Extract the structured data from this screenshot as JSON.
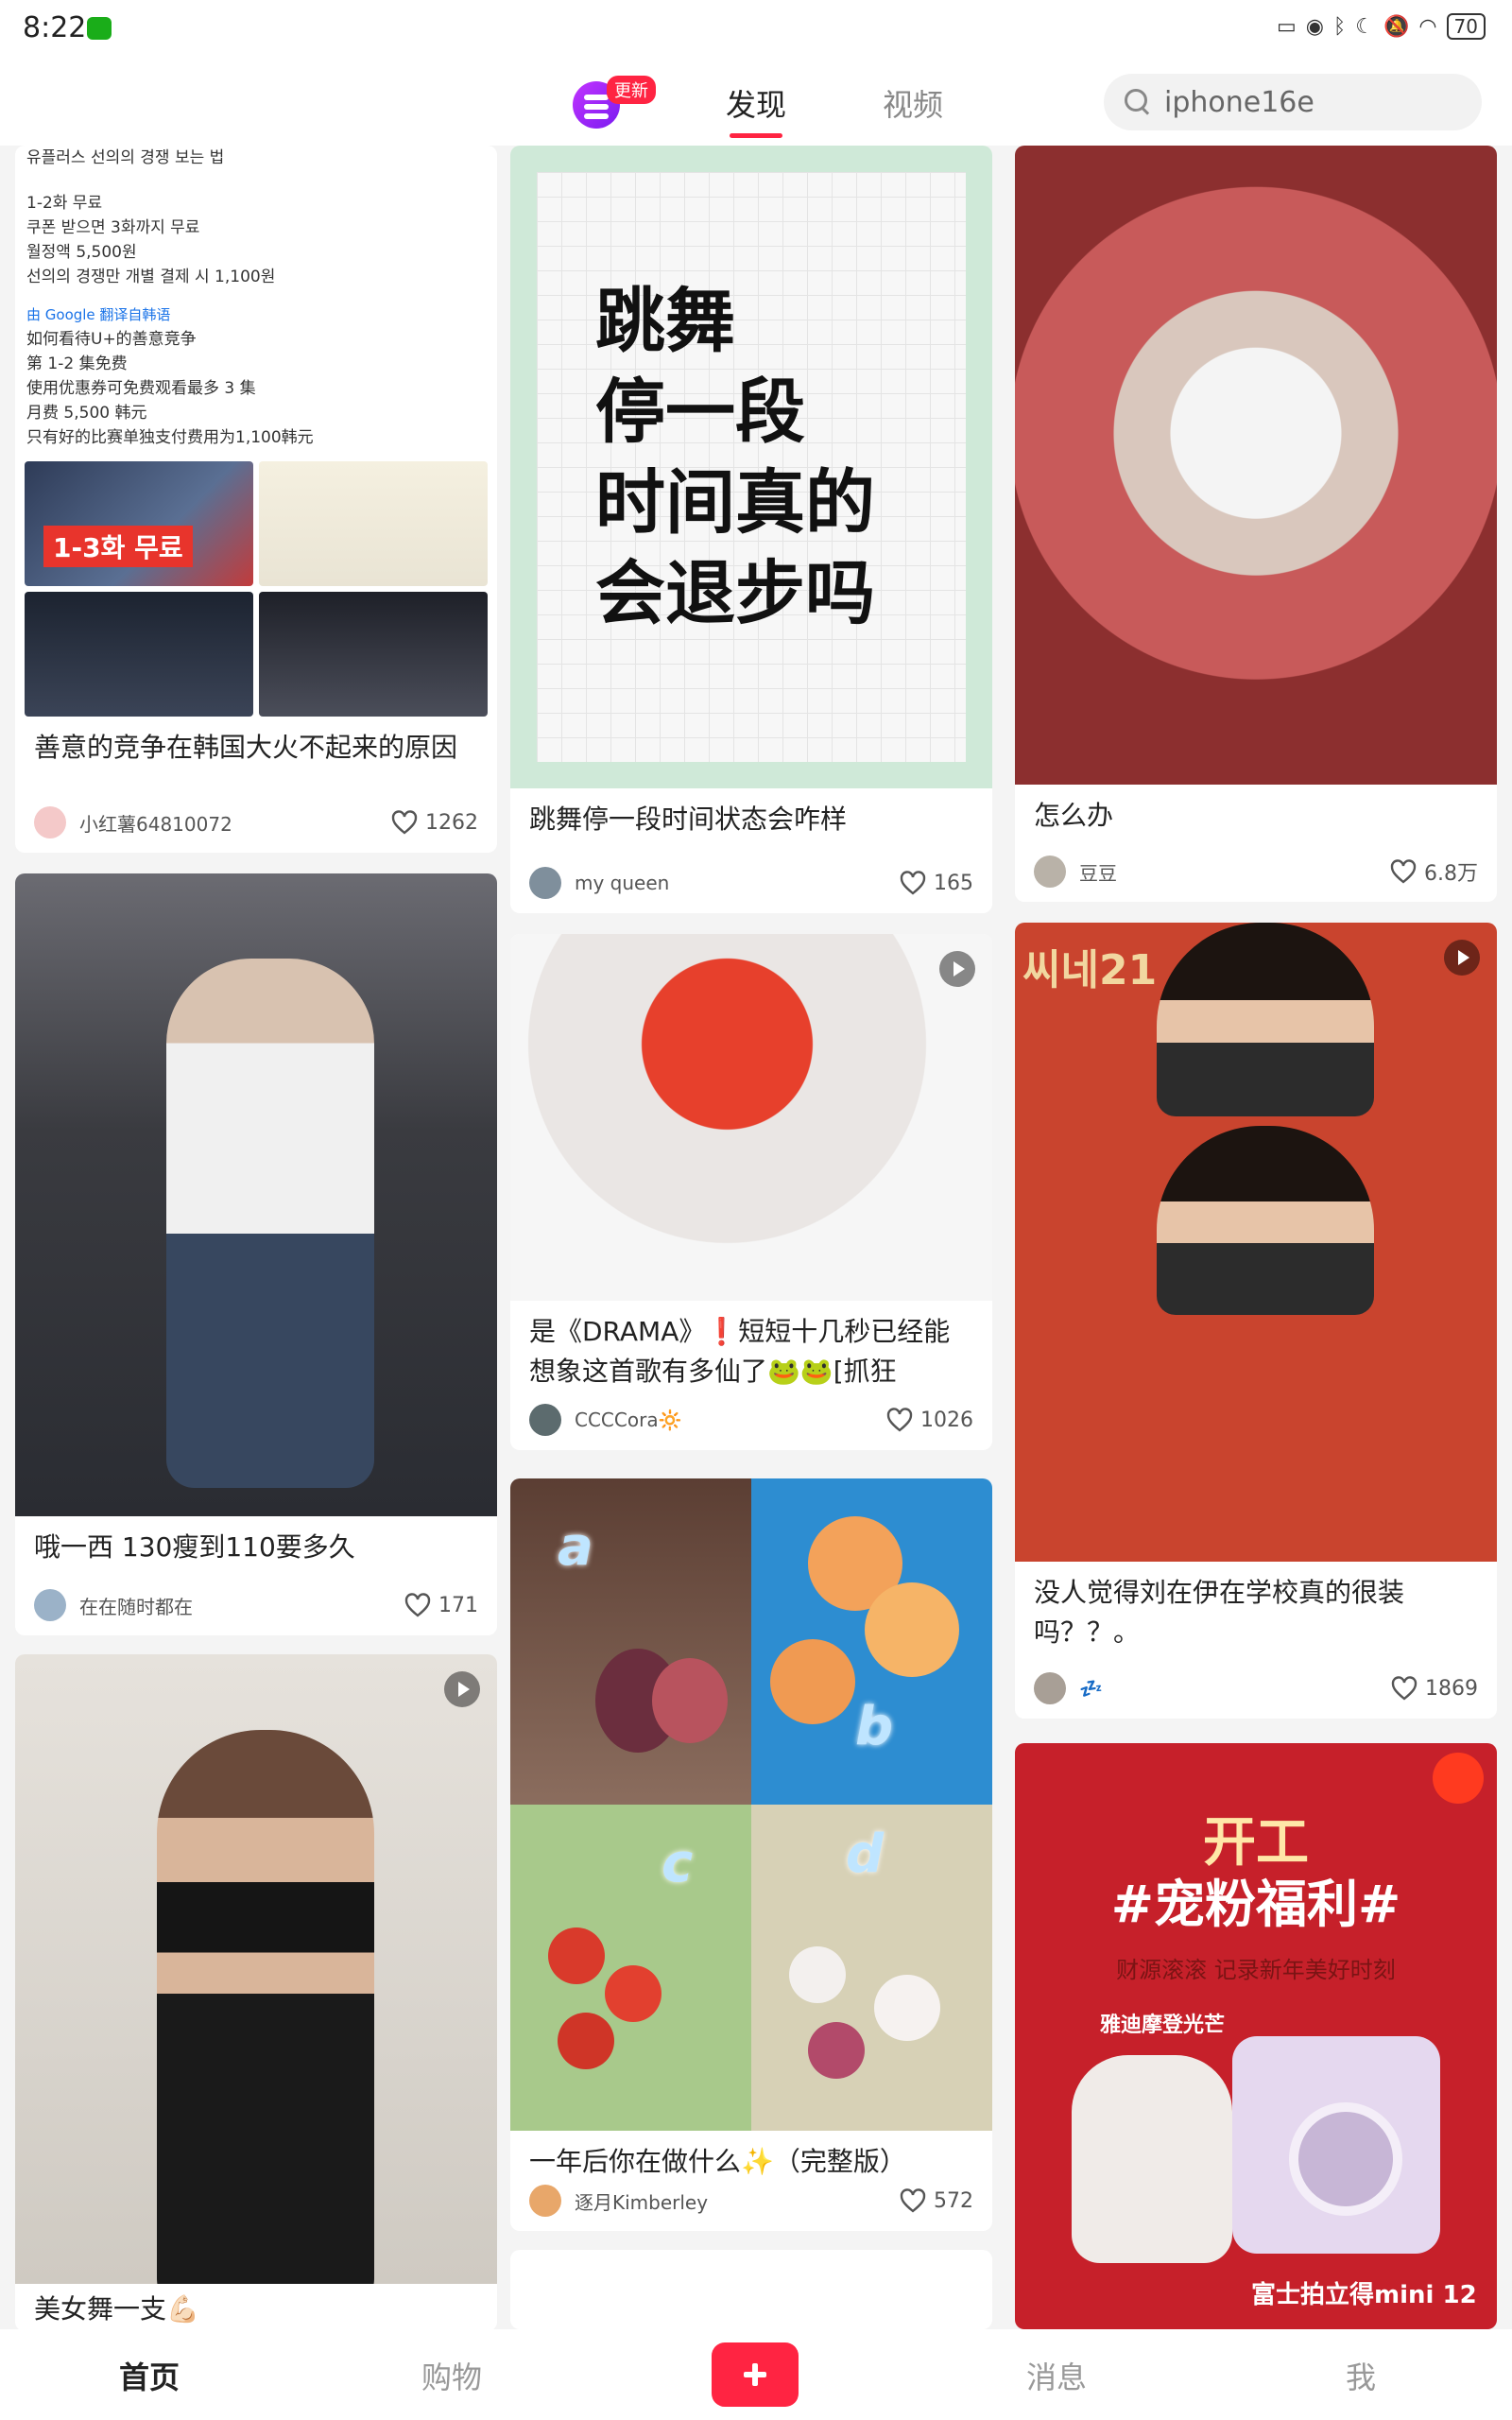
{
  "status_bar": {
    "time": "8:22",
    "battery": "70"
  },
  "top_nav": {
    "update_badge": "更新",
    "tabs": [
      {
        "label": "发现",
        "active": true
      },
      {
        "label": "视频",
        "active": false
      }
    ],
    "search_placeholder": "iphone16e"
  },
  "feed": {
    "col1": [
      {
        "doc_lines": [
          "유플러스 선의의 경쟁 보는 법",
          "",
          "1-2화 무료",
          "쿠폰 받으면 3화까지 무료",
          "월정액 5,500원",
          "선의의 경쟁만 개별 결제 시 1,100원"
        ],
        "google_note": "由 Google 翻译自韩语",
        "doc_lines_cn": [
          "如何看待U+的善意竞争",
          "第 1-2 集免费",
          "使用优惠券可免费观看最多 3 集",
          "月费 5,500 韩元",
          "只有好的比赛单独支付费用为1,100韩元"
        ],
        "thumb_label": "1-3화 무료",
        "title": "善意的竞争在韩国大火不起来的原因",
        "author": "小红薯64810072",
        "likes": "1262"
      },
      {
        "title": "哦一西 130瘦到110要多久",
        "author": "在在随时都在",
        "likes": "171"
      },
      {
        "title": "美女舞一支💪🏻",
        "video": true
      }
    ],
    "col2": [
      {
        "note_lines": [
          "跳舞",
          "停一段",
          "时间真的",
          "会退步吗"
        ],
        "title": "跳舞停一段时间状态会咋样",
        "author": "my queen",
        "likes": "165"
      },
      {
        "title": "是《DRAMA》❗️短短十几秒已经能想象这首歌有多仙了🐸🐸[抓狂",
        "author": "CCCCora🔆",
        "likes": "1026",
        "video": true
      },
      {
        "letters": [
          "a",
          "b",
          "c",
          "d"
        ],
        "title": "一年后你在做什么✨（完整版）",
        "author": "逐月Kimberley",
        "likes": "572"
      }
    ],
    "col3": [
      {
        "title": "怎么办",
        "author": "豆豆",
        "likes": "6.8万"
      },
      {
        "header": "씨네21",
        "title": "没人觉得刘在伊在学校真的很装吗？？。",
        "author": "💤",
        "likes": "1869",
        "video": true
      },
      {
        "promo_lines": [
          "开工",
          "#宠粉福利#",
          "财源滚滚 记录新年美好时刻",
          "雅迪摩登光芒",
          "富士拍立得mini 12"
        ]
      }
    ]
  },
  "bottom_nav": {
    "home": "首页",
    "shop": "购物",
    "messages": "消息",
    "me": "我"
  }
}
